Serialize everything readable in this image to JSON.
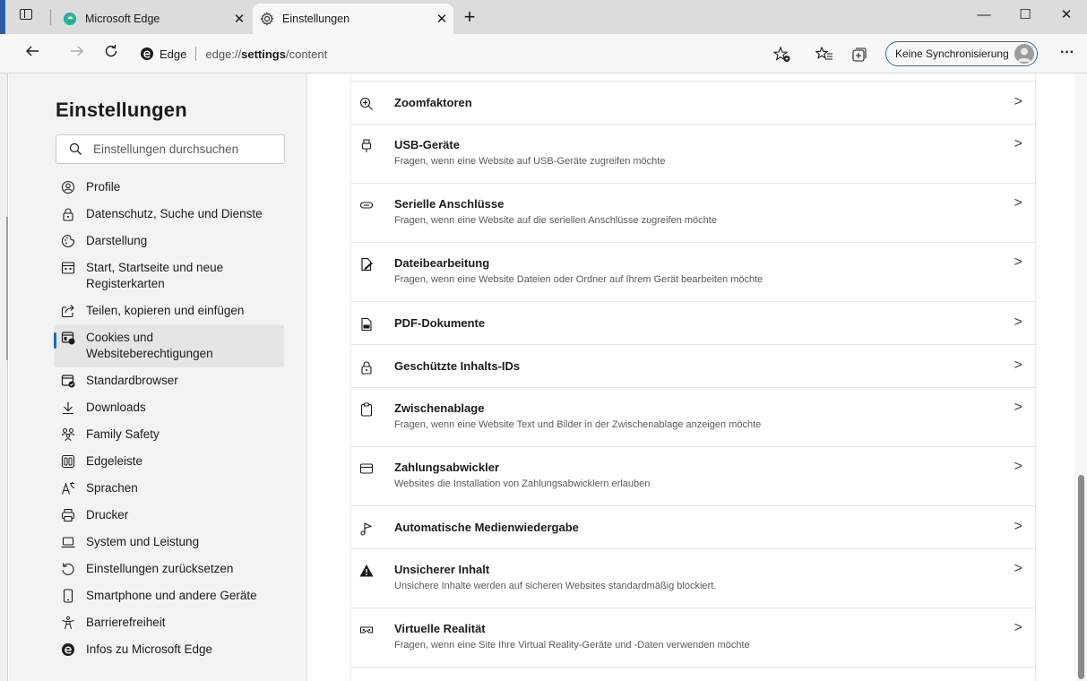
{
  "tabs": [
    {
      "title": "Microsoft Edge",
      "close": "✕",
      "icon": "edge-logo-icon"
    },
    {
      "title": "Einstellungen",
      "close": "✕",
      "icon": "gear-icon"
    }
  ],
  "window": {
    "minimize": "—",
    "maximize": "☐",
    "close": "✕",
    "new_tab": "+"
  },
  "address": {
    "site_label": "Edge",
    "url_prefix": "edge://",
    "url_bold": "settings",
    "url_suffix": "/content"
  },
  "toolbar": {
    "sync_label": "Keine Synchronisierung",
    "more": "···"
  },
  "sidebar": {
    "title": "Einstellungen",
    "search_placeholder": "Einstellungen durchsuchen",
    "items": [
      {
        "label": "Profile",
        "icon": "profile-icon"
      },
      {
        "label": "Datenschutz, Suche und Dienste",
        "icon": "lock-icon"
      },
      {
        "label": "Darstellung",
        "icon": "appearance-icon"
      },
      {
        "label": "Start, Startseite und neue Registerkarten",
        "icon": "start-page-icon"
      },
      {
        "label": "Teilen, kopieren und einfügen",
        "icon": "share-icon"
      },
      {
        "label": "Cookies und Websiteberechtigungen",
        "icon": "cookies-icon",
        "selected": true
      },
      {
        "label": "Standardbrowser",
        "icon": "default-browser-icon"
      },
      {
        "label": "Downloads",
        "icon": "download-icon"
      },
      {
        "label": "Family Safety",
        "icon": "family-icon"
      },
      {
        "label": "Edgeleiste",
        "icon": "edge-bar-icon"
      },
      {
        "label": "Sprachen",
        "icon": "language-icon"
      },
      {
        "label": "Drucker",
        "icon": "printer-icon"
      },
      {
        "label": "System und Leistung",
        "icon": "laptop-icon"
      },
      {
        "label": "Einstellungen zurücksetzen",
        "icon": "reset-icon"
      },
      {
        "label": "Smartphone und andere Geräte",
        "icon": "phone-icon"
      },
      {
        "label": "Barrierefreiheit",
        "icon": "accessibility-icon"
      },
      {
        "label": "Infos zu Microsoft Edge",
        "icon": "edge-logo-icon"
      }
    ]
  },
  "content": {
    "rows": [
      {
        "title": "Zoomfaktoren",
        "desc": "",
        "icon": "zoom-icon"
      },
      {
        "title": "USB-Geräte",
        "desc": "Fragen, wenn eine Website auf USB-Geräte zugreifen möchte",
        "icon": "usb-icon"
      },
      {
        "title": "Serielle Anschlüsse",
        "desc": "Fragen, wenn eine Website auf die seriellen Anschlüsse zugreifen möchte",
        "icon": "serial-port-icon"
      },
      {
        "title": "Dateibearbeitung",
        "desc": "Fragen, wenn eine Website Dateien oder Ordner auf Ihrem Gerät bearbeiten möchte",
        "icon": "file-edit-icon"
      },
      {
        "title": "PDF-Dokumente",
        "desc": "",
        "icon": "pdf-icon"
      },
      {
        "title": "Geschützte Inhalts-IDs",
        "desc": "",
        "icon": "protected-content-icon"
      },
      {
        "title": "Zwischenablage",
        "desc": "Fragen, wenn eine Website Text und Bilder in der Zwischenablage anzeigen möchte",
        "icon": "clipboard-icon"
      },
      {
        "title": "Zahlungsabwickler",
        "desc": "Websites die Installation von Zahlungsabwicklern erlauben",
        "icon": "payment-card-icon"
      },
      {
        "title": "Automatische Medienwiedergabe",
        "desc": "",
        "icon": "media-autoplay-icon"
      },
      {
        "title": "Unsicherer Inhalt",
        "desc": "Unsichere Inhalte werden auf sicheren Websites standardmäßig blockiert.",
        "icon": "warning-icon"
      },
      {
        "title": "Virtuelle Realität",
        "desc": "Fragen, wenn eine Site Ihre Virtual Reality-Geräte und -Daten verwenden möchte",
        "icon": "vr-headset-icon"
      }
    ],
    "chevron": ">"
  }
}
